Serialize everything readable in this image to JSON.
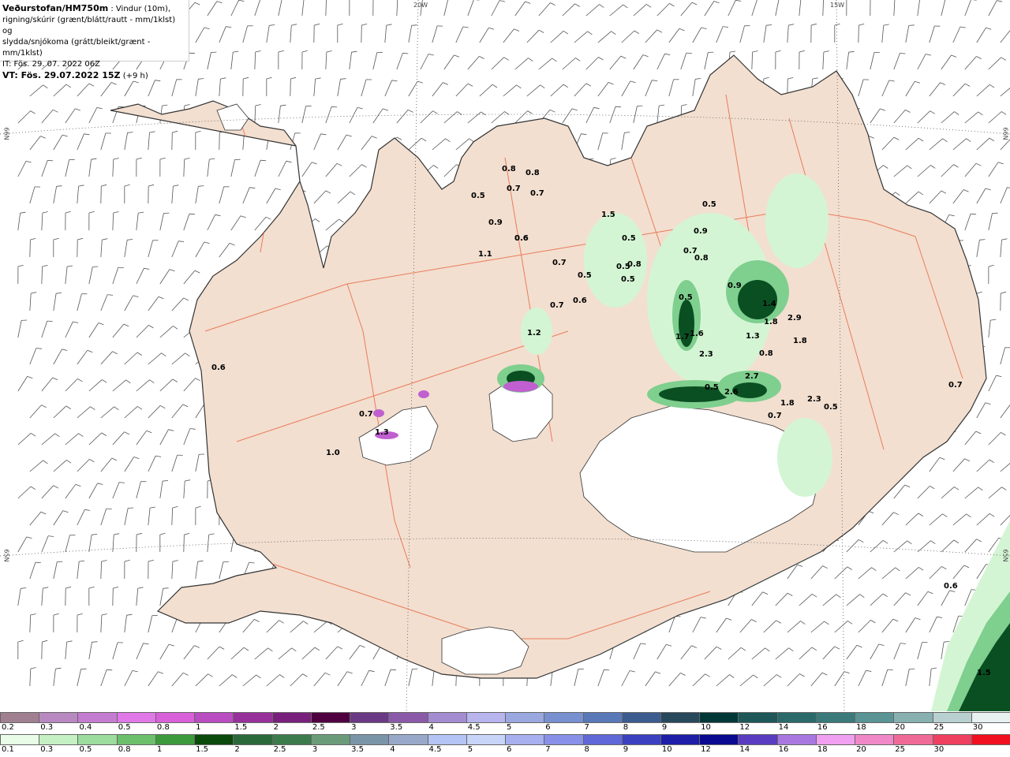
{
  "header": {
    "brand": "Veðurstofan/HM750m",
    "desc1": ": Vindur (10m),",
    "desc2": "rigning/skúrir (grænt/blátt/rautt - mm/1klst) og",
    "desc3": "slydda/snjókoma (grátt/bleikt/grænt - mm/1klst)",
    "init_time": "IT: Fös. 29. 07. 2022 06Z",
    "valid_label": "VT: Fös. 29.07.2022 15Z",
    "valid_offset": "(+9 h)"
  },
  "graticule": {
    "lon_labels": [
      "20W",
      "15W"
    ],
    "lat_labels": [
      "66N",
      "65N",
      "66N",
      "65N"
    ]
  },
  "colors": {
    "sea": "#ffffff",
    "land": "#f2dfd0",
    "ice": "#ffffff",
    "roads": "#e8643c",
    "coast": "#333333",
    "wind_barb": "#555555",
    "rain_light": "#d4f5d4",
    "rain_mid": "#7fcf8f",
    "rain_dark": "#0a4f22"
  },
  "precip_labels": [
    "0.8",
    "0.8",
    "0.5",
    "0.7",
    "0.9",
    "1.1",
    "0.7",
    "0.5",
    "0.6",
    "0.7",
    "0.6",
    "1.2",
    "1.5",
    "0.5",
    "0.5",
    "0.8",
    "0.5",
    "0.5",
    "0.9",
    "0.7",
    "0.8",
    "0.9",
    "1.4",
    "2.9",
    "1.8",
    "1.8",
    "0.5",
    "1.7",
    "1.6",
    "2.3",
    "1.3",
    "0.8",
    "2.7",
    "0.5",
    "0.7",
    "2.6",
    "1.8",
    "2.3",
    "0.5",
    "0.7",
    "0.6",
    "0.7",
    "1.0",
    "1.3",
    "0.6",
    "0.7",
    "0.6",
    "1.5"
  ],
  "legend_snow": {
    "labels": [
      "0.2",
      "0.3",
      "0.4",
      "0.5",
      "0.8",
      "1",
      "1.5",
      "2",
      "2.5",
      "3",
      "3.5",
      "4",
      "4.5",
      "5",
      "6",
      "7",
      "8",
      "9",
      "10",
      "12",
      "14",
      "16",
      "18",
      "20",
      "25",
      "30"
    ],
    "colors": [
      "#a08090",
      "#b888c0",
      "#c47cd0",
      "#e078e8",
      "#d860d8",
      "#b84cc0",
      "#98309c",
      "#78207c",
      "#500040",
      "#6a3a84",
      "#8a5aa8",
      "#a48cd0",
      "#b8b4ee",
      "#9aa8e0",
      "#7890d0",
      "#5878b8",
      "#3c5c90",
      "#28485c",
      "#003838",
      "#1e5858",
      "#2a6a6a",
      "#3a7a7a",
      "#5a9494",
      "#88b0b0",
      "#b8d0d0",
      "#e8f0f0"
    ]
  },
  "legend_rain": {
    "labels": [
      "0.1",
      "0.3",
      "0.5",
      "0.8",
      "1",
      "1.5",
      "2",
      "2.5",
      "3",
      "3.5",
      "4",
      "4.5",
      "5",
      "6",
      "7",
      "8",
      "9",
      "10",
      "12",
      "14",
      "16",
      "18",
      "20",
      "25",
      "30"
    ],
    "colors": [
      "#e8fce8",
      "#c4f0c4",
      "#9cdc9c",
      "#6cc06c",
      "#3c9a3c",
      "#0a4a0a",
      "#2a6a3a",
      "#3c7c4c",
      "#6a9c7a",
      "#7a94a8",
      "#98a8c8",
      "#b4c4f4",
      "#c8d4f8",
      "#a8b0f0",
      "#8890e8",
      "#6068d8",
      "#3a40c0",
      "#1e1ea8",
      "#0a0a90",
      "#5a3cc0",
      "#a878e0",
      "#f0a0f0",
      "#f088c8",
      "#f06a98",
      "#f04060",
      "#f01020"
    ]
  }
}
